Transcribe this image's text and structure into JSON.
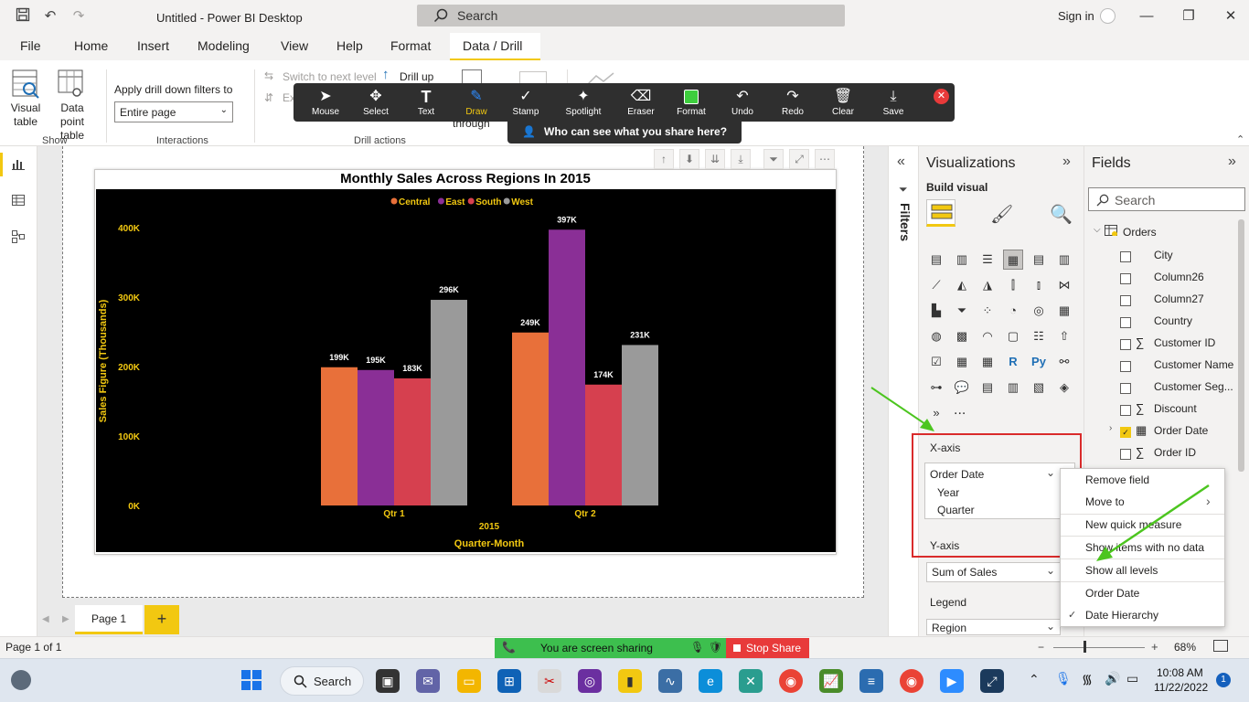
{
  "window": {
    "title": "Untitled - Power BI Desktop",
    "search_placeholder": "Search",
    "sign_in": "Sign in"
  },
  "menu": {
    "tabs": [
      "File",
      "Home",
      "Insert",
      "Modeling",
      "View",
      "Help",
      "Format",
      "Data / Drill"
    ]
  },
  "ribbon": {
    "visual_table": "Visual table",
    "data_point_table": "Data point table",
    "group_show": "Show",
    "apply_drill_label": "Apply drill down filters to",
    "apply_drill_value": "Entire page",
    "group_interactions": "Interactions",
    "switch_next_level": "Switch to next level",
    "drill_up": "Drill up",
    "expand_partial": "Ex",
    "through_partial": "through",
    "group_drill_actions": "Drill actions"
  },
  "annotation_toolbar": {
    "buttons": [
      "Mouse",
      "Select",
      "Text",
      "Draw",
      "Stamp",
      "Spotlight",
      "Eraser",
      "Format",
      "Undo",
      "Redo",
      "Clear",
      "Save"
    ],
    "active": "Draw",
    "who_can_see": "Who can see what you share here?"
  },
  "chart_data": {
    "type": "bar",
    "title": "Monthly Sales Across Regions In 2015",
    "xlabel": "Quarter-Month",
    "ylabel": "Sales Figure (Thousands)",
    "x_group_label": "2015",
    "categories": [
      "Qtr 1",
      "Qtr 2"
    ],
    "series": [
      {
        "name": "Central",
        "color": "#e8703a",
        "values": [
          199,
          249
        ]
      },
      {
        "name": "East",
        "color": "#8a2f96",
        "values": [
          195,
          397
        ]
      },
      {
        "name": "South",
        "color": "#d6404f",
        "values": [
          183,
          174
        ]
      },
      {
        "name": "West",
        "color": "#9a9a9a",
        "values": [
          296,
          231
        ]
      }
    ],
    "data_labels": [
      [
        "199K",
        "249K"
      ],
      [
        "195K",
        "397K"
      ],
      [
        "183K",
        "174K"
      ],
      [
        "296K",
        "231K"
      ]
    ],
    "yticks": [
      "0K",
      "100K",
      "200K",
      "300K",
      "400K"
    ],
    "ylim": [
      0,
      400
    ],
    "background": "#000000",
    "axis_text_color": "#f2c811",
    "legend_position": "top-center",
    "grid": false
  },
  "filters": {
    "label": "Filters"
  },
  "visualizations": {
    "title": "Visualizations",
    "build_visual": "Build visual",
    "more": "...",
    "x_axis_label": "X-axis",
    "x_axis_field": "Order Date",
    "x_axis_levels": [
      "Year",
      "Quarter"
    ],
    "y_axis_label": "Y-axis",
    "y_axis_field": "Sum of Sales",
    "legend_label": "Legend",
    "legend_field": "Region"
  },
  "fields": {
    "title": "Fields",
    "search_placeholder": "Search",
    "table_name": "Orders",
    "items": [
      {
        "name": "City",
        "sigma": false,
        "checked": false
      },
      {
        "name": "Column26",
        "sigma": false,
        "checked": false
      },
      {
        "name": "Column27",
        "sigma": false,
        "checked": false
      },
      {
        "name": "Country",
        "sigma": false,
        "checked": false
      },
      {
        "name": "Customer ID",
        "sigma": true,
        "checked": false
      },
      {
        "name": "Customer Name",
        "sigma": false,
        "checked": false
      },
      {
        "name": "Customer Seg...",
        "sigma": false,
        "checked": false
      },
      {
        "name": "Discount",
        "sigma": true,
        "checked": false
      },
      {
        "name": "Order Date",
        "sigma": false,
        "checked": true
      },
      {
        "name": "Order ID",
        "sigma": true,
        "checked": false
      }
    ]
  },
  "context_menu": {
    "items": [
      "Remove field",
      "Move to",
      "New quick measure",
      "Show items with no data",
      "Show all levels",
      "Order Date",
      "Date Hierarchy"
    ],
    "checked": "Date Hierarchy"
  },
  "pages": {
    "tab": "Page 1",
    "add": "+"
  },
  "status": {
    "page_count": "Page 1 of 1",
    "sharing": "You are screen sharing",
    "stop_share": "Stop Share",
    "zoom": "68%"
  },
  "taskbar": {
    "search": "Search",
    "time": "10:08 AM",
    "date": "11/22/2022",
    "notifications": "1"
  },
  "colors": {
    "accent": "#f2c811",
    "highlight_box": "#d92b2b",
    "annotation_arrow": "#4cc51f"
  }
}
